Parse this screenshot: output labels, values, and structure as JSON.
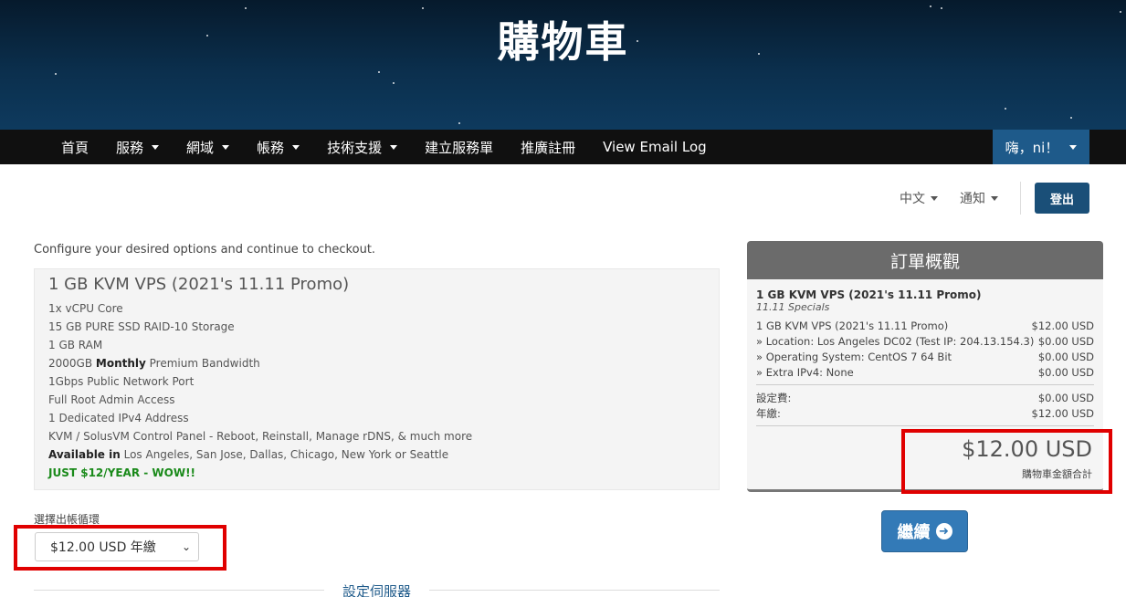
{
  "header": {
    "title": "購物車"
  },
  "nav": {
    "items": [
      {
        "label": "首頁",
        "dropdown": false
      },
      {
        "label": "服務",
        "dropdown": true
      },
      {
        "label": "網域",
        "dropdown": true
      },
      {
        "label": "帳務",
        "dropdown": true
      },
      {
        "label": "技術支援",
        "dropdown": true
      },
      {
        "label": "建立服務單",
        "dropdown": false
      },
      {
        "label": "推廣註冊",
        "dropdown": false
      },
      {
        "label": "View Email Log",
        "dropdown": false
      }
    ],
    "user_label": "嗨，ni！"
  },
  "topbar": {
    "language": "中文",
    "notifications": "通知",
    "logout": "登出"
  },
  "intro": "Configure your desired options and continue to checkout.",
  "product": {
    "name": "1 GB KVM VPS (2021's 11.11 Promo)",
    "features": {
      "f1": "1x vCPU Core",
      "f2": "15 GB PURE SSD RAID-10 Storage",
      "f3": "1 GB RAM",
      "f4_pre": "2000GB ",
      "f4_bold": "Monthly",
      "f4_post": " Premium Bandwidth",
      "f5": "1Gbps Public Network Port",
      "f6": "Full Root Admin Access",
      "f7": "1 Dedicated IPv4 Address",
      "f8": "KVM / SolusVM Control Panel - Reboot, Reinstall, Manage rDNS, & much more",
      "f9_bold": "Available in",
      "f9_post": " Los Angeles, San Jose, Dallas, Chicago, New York or Seattle",
      "promo": "JUST $12/YEAR - WOW!!"
    }
  },
  "billing": {
    "label": "選擇出帳循環",
    "selected": "$12.00 USD 年繳"
  },
  "server_section": "設定伺服器",
  "summary": {
    "title": "訂單概觀",
    "product": "1 GB KVM VPS (2021's 11.11 Promo)",
    "group": "11.11 Specials",
    "lines": [
      {
        "label": "1 GB KVM VPS (2021's 11.11 Promo)",
        "amount": "$12.00 USD"
      },
      {
        "label": "» Location: Los Angeles DC02 (Test IP: 204.13.154.3)",
        "amount": "$0.00 USD"
      },
      {
        "label": "» Operating System: CentOS 7 64 Bit",
        "amount": "$0.00 USD"
      },
      {
        "label": "» Extra IPv4: None",
        "amount": "$0.00 USD"
      }
    ],
    "setup_label": "設定費:",
    "setup_amount": "$0.00 USD",
    "annual_label": "年繳:",
    "annual_amount": "$12.00 USD",
    "total": "$12.00 USD",
    "total_label": "購物車金額合計"
  },
  "continue_button": "繼續"
}
